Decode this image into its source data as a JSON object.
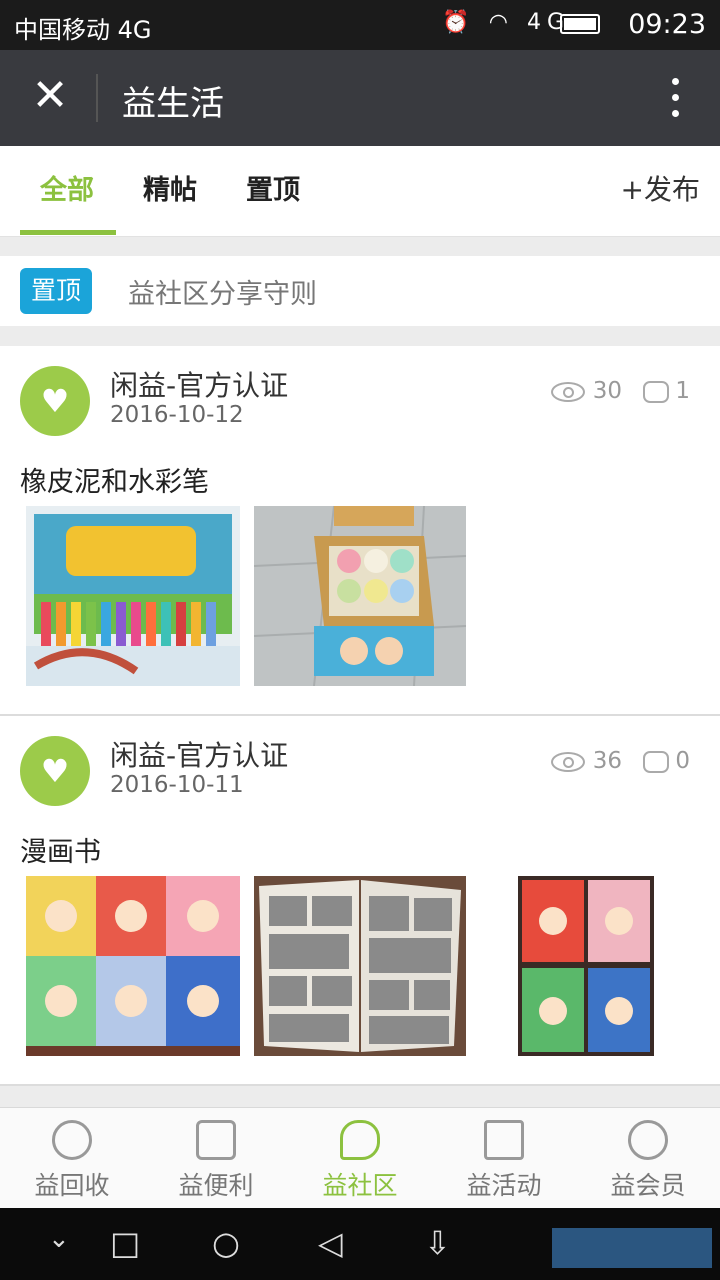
{
  "status_bar": {
    "carrier": "中国移动 4G",
    "time": "09:23",
    "network_label": "4G"
  },
  "title_bar": {
    "close_icon": "close-icon",
    "title": "益生活",
    "more_icon": "more-vertical-icon"
  },
  "tabs": {
    "items": [
      {
        "label": "全部",
        "active": true
      },
      {
        "label": "精帖",
        "active": false
      },
      {
        "label": "置顶",
        "active": false
      }
    ],
    "publish_label": "+发布"
  },
  "pinned": {
    "badge": "置顶",
    "text": "益社区分享守则"
  },
  "posts": [
    {
      "author": "闲益-官方认证",
      "date": "2016-10-12",
      "views": "30",
      "comments": "1",
      "title": "橡皮泥和水彩笔",
      "images": [
        "crayon-box-photo",
        "clay-pots-photo"
      ]
    },
    {
      "author": "闲益-官方认证",
      "date": "2016-10-11",
      "views": "36",
      "comments": "0",
      "title": "漫画书",
      "images": [
        "comic-covers-photo",
        "comic-open-pages-photo",
        "comic-stack-photo"
      ]
    }
  ],
  "bottom_nav": {
    "items": [
      {
        "label": "益回收",
        "icon": "recycle-icon",
        "active": false
      },
      {
        "label": "益便利",
        "icon": "store-icon",
        "active": false
      },
      {
        "label": "益社区",
        "icon": "chat-bubbles-icon",
        "active": true
      },
      {
        "label": "益活动",
        "icon": "gift-icon",
        "active": false
      },
      {
        "label": "益会员",
        "icon": "member-face-icon",
        "active": false
      }
    ]
  },
  "colors": {
    "accent": "#8cc13f",
    "title_bar": "#393a3f",
    "pin_badge": "#1ba4d9"
  }
}
